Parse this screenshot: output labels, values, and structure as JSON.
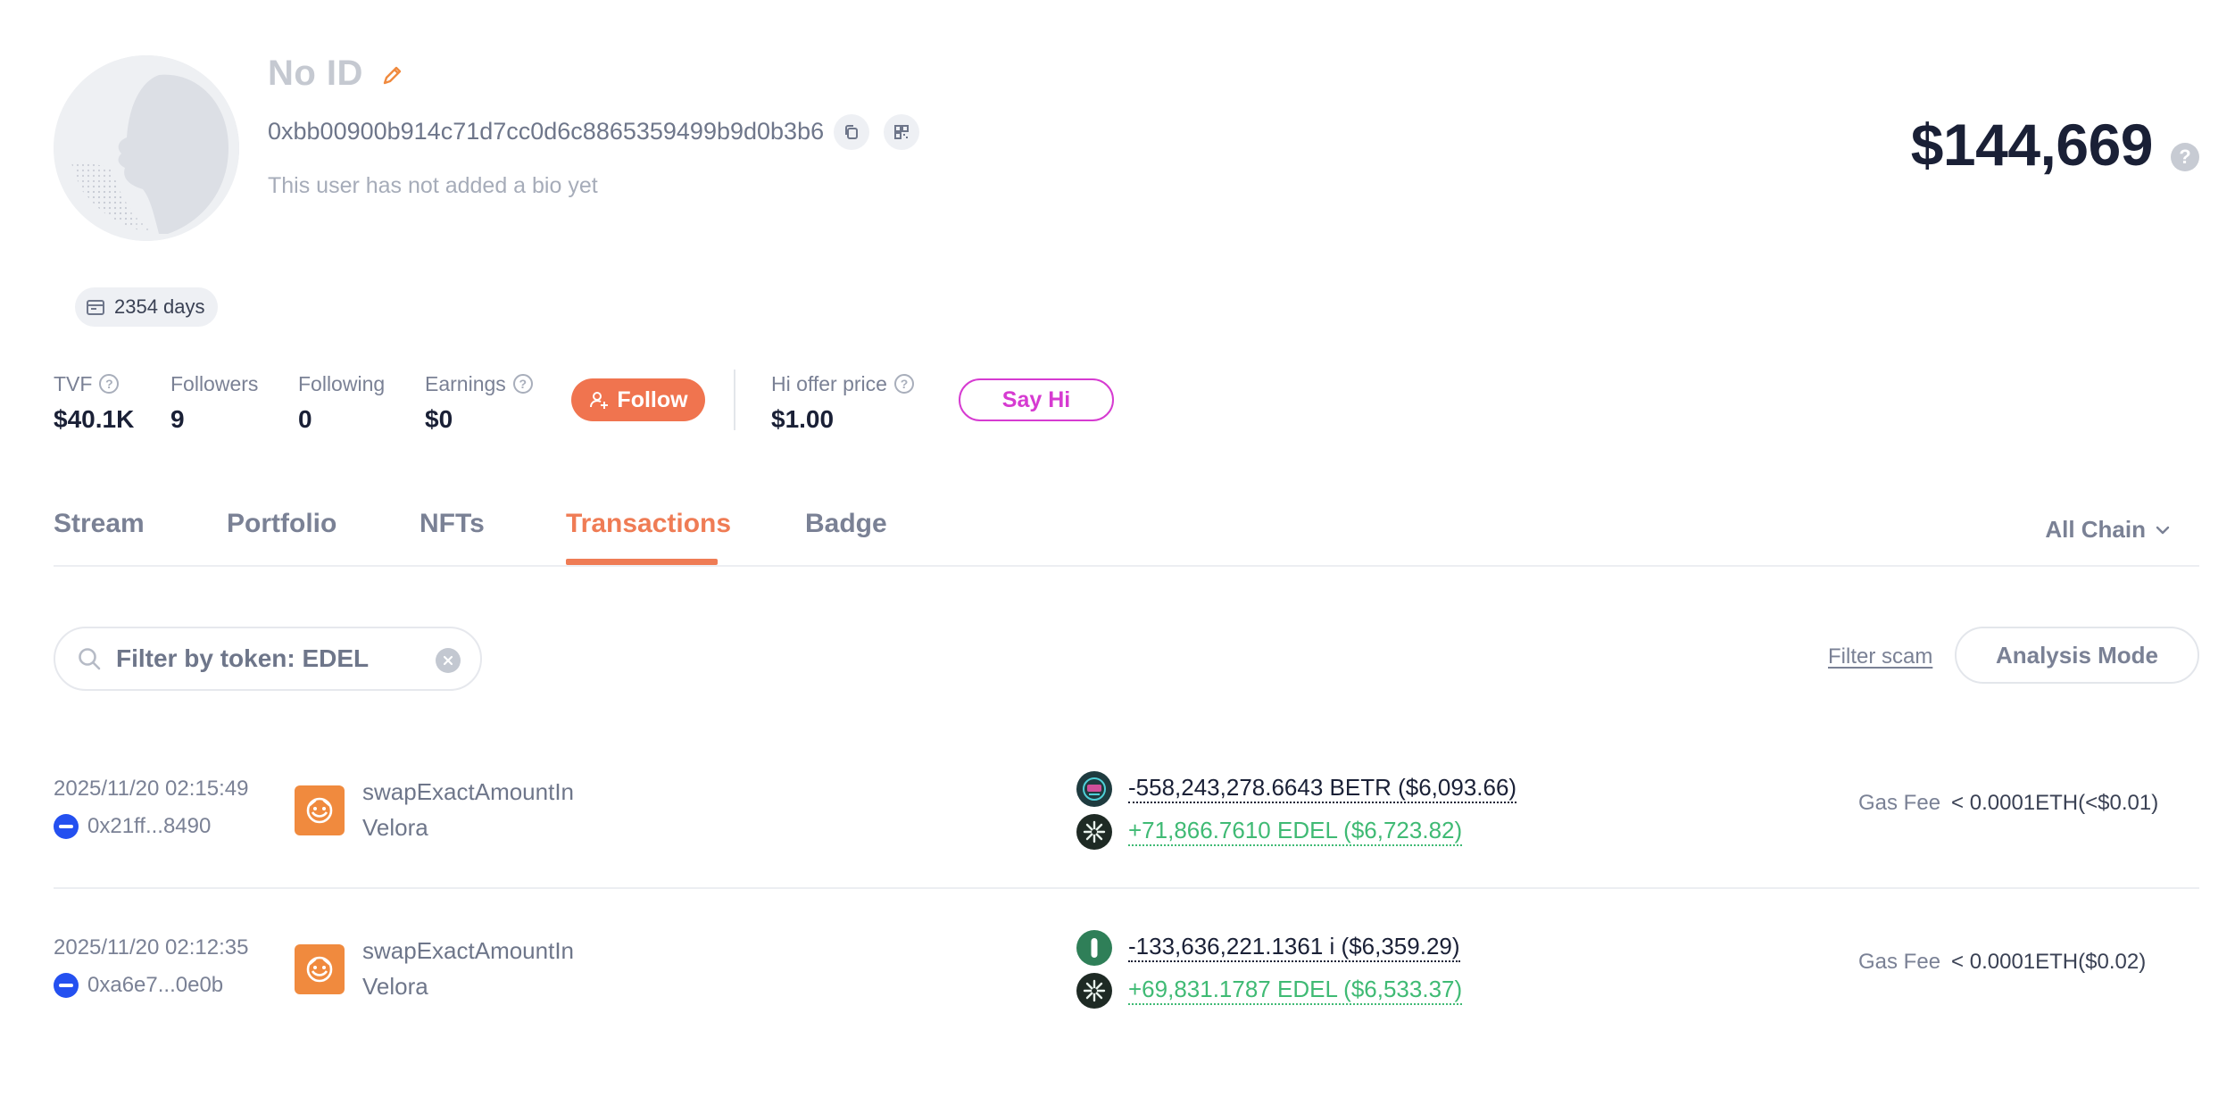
{
  "profile": {
    "name": "No ID",
    "address": "0xbb00900b914c71d7cc0d6c8865359499b9d0b3b6",
    "bio": "This user has not added a bio yet",
    "days": "2354 days",
    "balance": "$144,669",
    "balance_help": "?"
  },
  "stats": {
    "tvf": {
      "label": "TVF",
      "value": "$40.1K"
    },
    "followers": {
      "label": "Followers",
      "value": "9"
    },
    "following": {
      "label": "Following",
      "value": "0"
    },
    "earnings": {
      "label": "Earnings",
      "value": "$0"
    },
    "follow_label": "Follow",
    "hi_offer": {
      "label": "Hi offer price",
      "value": "$1.00"
    },
    "say_hi_label": "Say Hi",
    "help_glyph": "?"
  },
  "tabs": [
    {
      "label": "Stream"
    },
    {
      "label": "Portfolio"
    },
    {
      "label": "NFTs"
    },
    {
      "label": "Transactions"
    },
    {
      "label": "Badge"
    }
  ],
  "chain_filter": "All Chain",
  "filters": {
    "token_filter_value": "Filter by token: EDEL",
    "filter_scam": "Filter scam",
    "analysis_mode": "Analysis Mode"
  },
  "transactions": [
    {
      "time": "2025/11/20 02:15:49",
      "hash": "0x21ff...8490",
      "method": "swapExactAmountIn",
      "dapp": "Velora",
      "out": "-558,243,278.6643 BETR ($6,093.66)",
      "in": "+71,866.7610 EDEL ($6,723.82)",
      "gas_label": "Gas Fee",
      "gas_value": "< 0.0001ETH(<$0.01)"
    },
    {
      "time": "2025/11/20 02:12:35",
      "hash": "0xa6e7...0e0b",
      "method": "swapExactAmountIn",
      "dapp": "Velora",
      "out": "-133,636,221.1361 i ($6,359.29)",
      "in": "+69,831.1787 EDEL ($6,533.37)",
      "gas_label": "Gas Fee",
      "gas_value": "< 0.0001ETH($0.02)"
    }
  ],
  "colors": {
    "accent": "#ef7c55",
    "follow_bg": "#f0744f",
    "say_hi": "#d63bd1",
    "positive": "#3fba74",
    "chain_blue": "#2450f0",
    "velora_orange": "#f08a3e"
  },
  "icons": {
    "edit": "pencil-icon",
    "copy": "copy-icon",
    "qr": "qr-code-icon",
    "calendar": "calendar-icon",
    "follow": "add-user-icon",
    "search": "search-icon",
    "clear": "clear-icon",
    "chevron": "chevron-down-icon"
  }
}
